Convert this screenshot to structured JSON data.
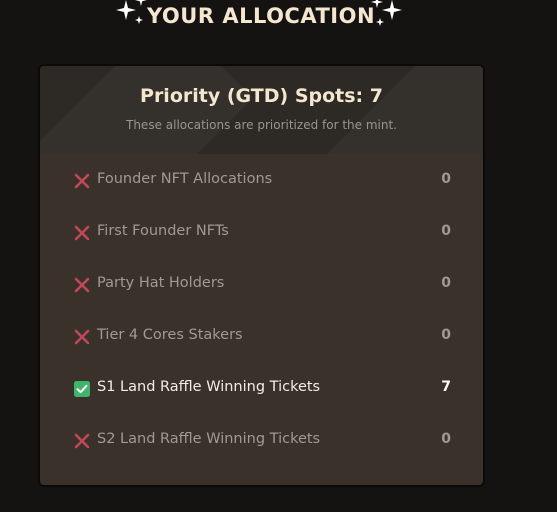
{
  "header": {
    "title": "YOUR ALLOCATION"
  },
  "panel": {
    "title": "Priority (GTD) Spots: 7",
    "subtitle": "These allocations are prioritized for the mint."
  },
  "allocations": [
    {
      "label": "Founder NFT Allocations",
      "count": "0",
      "status": "cross-icon"
    },
    {
      "label": "First Founder NFTs",
      "count": "0",
      "status": "cross-icon"
    },
    {
      "label": "Party Hat Holders",
      "count": "0",
      "status": "cross-icon"
    },
    {
      "label": "Tier 4 Cores Stakers",
      "count": "0",
      "status": "cross-icon"
    },
    {
      "label": "S1 Land Raffle Winning Tickets",
      "count": "7",
      "status": "check-icon"
    },
    {
      "label": "S2 Land Raffle Winning Tickets",
      "count": "0",
      "status": "cross-icon"
    }
  ],
  "colors": {
    "background": "#151312",
    "panel": "#3a312a",
    "panel_header": "#2d2925",
    "cross": "#c0485a",
    "check": "#3fb46b",
    "title": "#f4e6cf"
  }
}
